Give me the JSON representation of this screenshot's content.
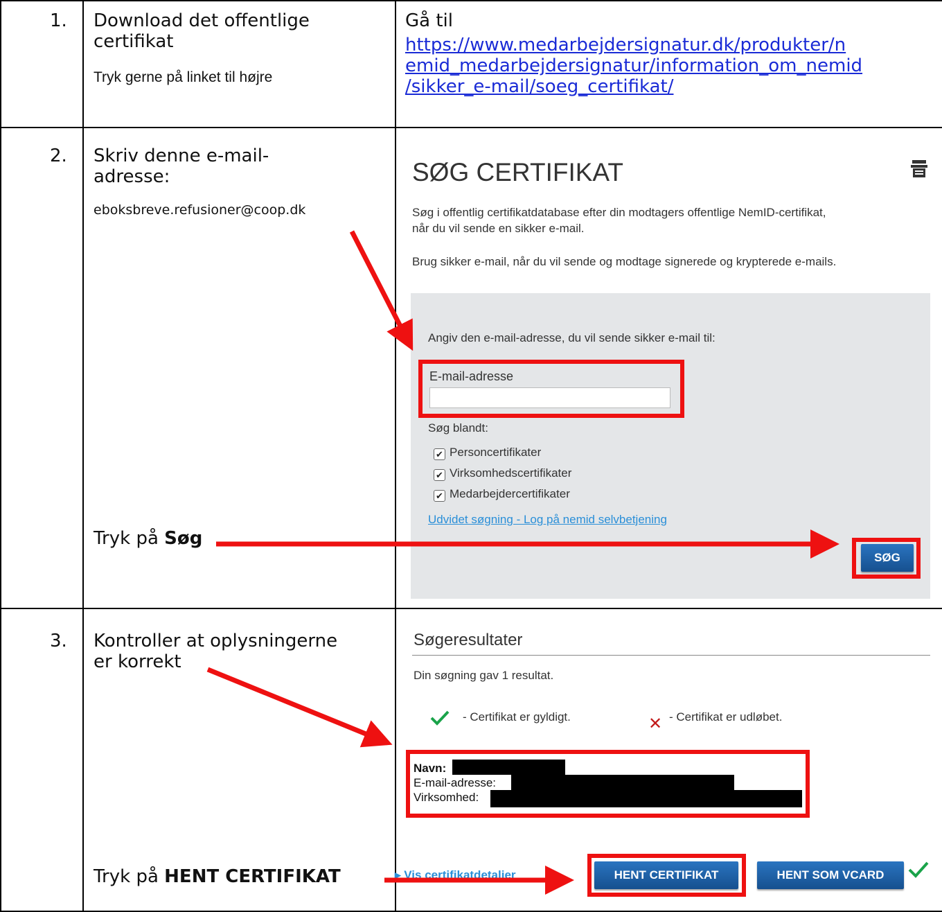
{
  "rows": [
    {
      "number": "1.",
      "title": "Download det offentlige certifikat",
      "note": "Tryk gerne på linket til højre",
      "goto_label": "Gå til",
      "link_lines": [
        "https://www.medarbejdersignatur.dk/produkter/n",
        "emid_medarbejdersignatur/information_om_nemid",
        "/sikker_e-mail/soeg_certifikat/"
      ]
    },
    {
      "number": "2.",
      "title_lines": [
        "Skriv denne e-mail-",
        "adresse:"
      ],
      "email": "eboksbreve.refusioner@coop.dk",
      "press_prefix": "Tryk på ",
      "press_bold": "Søg"
    },
    {
      "number": "3.",
      "title_lines": [
        "Kontroller at oplysningerne",
        "er korrekt"
      ],
      "press_prefix": "Tryk på ",
      "press_bold": "HENT CERTIFIKAT"
    }
  ],
  "search_panel": {
    "heading": "SØG CERTIFIKAT",
    "icon": "print-icon",
    "intro_lines": [
      "Søg i offentlig certifikatdatabase efter din modtagers offentlige NemID-certifikat,",
      "når du vil sende en sikker e-mail."
    ],
    "intro2": "Brug sikker e-mail, når du vil sende og modtage signerede og krypterede e-mails.",
    "form": {
      "prompt": "Angiv den e-mail-adresse, du vil sende sikker e-mail til:",
      "email_label": "E-mail-adresse",
      "email_value": "",
      "search_among": "Søg blandt:",
      "checkboxes": [
        "Personcertifikater",
        "Virksomhedscertifikater",
        "Medarbejdercertifikater"
      ],
      "advanced_link": "Udvidet søgning - Log på nemid selvbetjening",
      "search_button": "SØG"
    }
  },
  "results_panel": {
    "heading": "Søgeresultater",
    "count_text": "Din søgning gav 1 resultat.",
    "legend_valid": "- Certifikat er gyldigt.",
    "legend_expired": "- Certifikat er udløbet.",
    "fields": {
      "name": "Navn:",
      "email": "E-mail-adresse:",
      "company": "Virksomhed:"
    },
    "details_link": "Vis certifikatdetaljer",
    "get_cert_button": "HENT CERTIFIKAT",
    "get_vcard_button": "HENT SOM VCARD"
  },
  "colors": {
    "annotation_red": "#ee1111",
    "link_blue": "#1a2bd6",
    "panel_gray": "#e4e6e8",
    "button_blue": "#1f63a8"
  }
}
